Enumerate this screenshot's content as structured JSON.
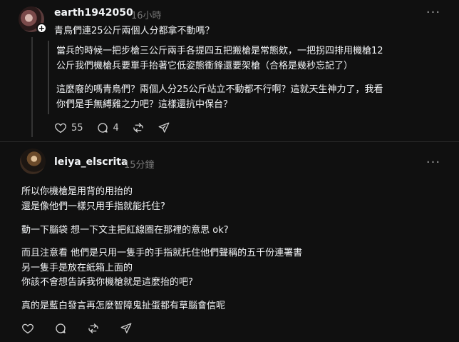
{
  "post1": {
    "username": "earth1942050",
    "time": "16小時",
    "title": "青鳥們連25公斤兩個人分都拿不動嗎？",
    "quote_para1_line1": "當兵的時候一把步槍三公斤兩手各提四五把搬槍是常態欸，一把拐四排用機槍12",
    "quote_para1_line2": "公斤我們機槍兵要單手抬著它低姿態衝鋒還要架槍（合格是幾秒忘記了）",
    "quote_para2_line1": "這麼廢的嗎青鳥們？兩個人分25公斤站立不動都不行啊？這就天生神力了，我看",
    "quote_para2_line2": "你們是手無縛雞之力吧？這樣還抗中保台？",
    "likes": "55",
    "comments": "4",
    "icons": [
      "heart-icon",
      "comment-icon",
      "repost-icon",
      "share-icon"
    ]
  },
  "post2": {
    "username": "leiya_elscrita",
    "time": "15分鐘",
    "lines": [
      "所以你機槍是用背的用抬的",
      "還是像他們一樣只用手指就能托住?",
      "動一下腦袋 想一下文主把紅線圈在那裡的意思 ok?",
      "而且注意看 他們是只用一隻手的手指就托住他們聲稱的五千份連署書",
      "另一隻手是放在紙箱上面的",
      "你該不會想告訴我你機槍就是這麼抬的吧?",
      "真的是藍白發言再怎麼智障鬼扯蛋都有草腦會信呢"
    ],
    "icons": [
      "heart-icon",
      "comment-icon",
      "repost-icon",
      "share-icon"
    ]
  },
  "colors": {
    "background": "#101010",
    "text": "#f3f5f7",
    "muted": "#777777"
  }
}
